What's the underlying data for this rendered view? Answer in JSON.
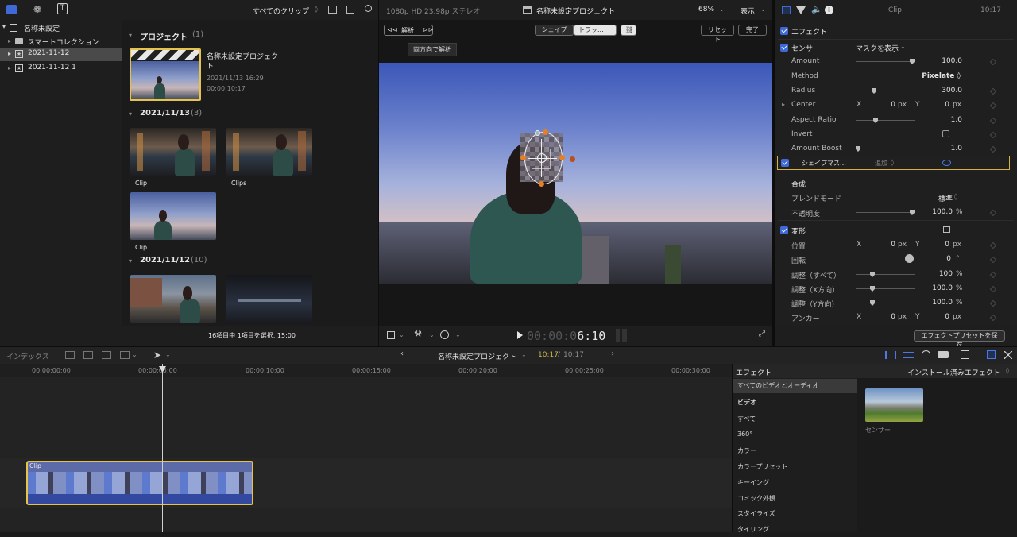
{
  "library": {
    "title": "名称未設定",
    "items": [
      {
        "label": "スマートコレクション"
      },
      {
        "label": "2021-11-12"
      },
      {
        "label": "2021-11-12 1"
      }
    ]
  },
  "browser": {
    "filter_label": "すべてのクリップ",
    "sections": [
      {
        "title": "プロジェクト",
        "count": "(1)"
      },
      {
        "title": "2021/11/13",
        "count": "(3)"
      },
      {
        "title": "2021/11/12",
        "count": "(10)"
      }
    ],
    "project": {
      "name": "名称未設定プロジェク\nト",
      "date": "2021/11/13 16:29",
      "duration": "00:00:10:17"
    },
    "clips": [
      {
        "label": "Clip"
      },
      {
        "label": "Clips"
      },
      {
        "label": "Clip"
      }
    ],
    "status": "16項目中 1項目を選択, 15:00"
  },
  "viewer": {
    "format": "1080p HD 23.98p ステレオ",
    "project_title": "名称未設定プロジェクト",
    "zoom": "68%",
    "display_label": "表示",
    "analyze_label": "解析",
    "tooltip": "両方向で解析",
    "shape_label": "シェイプ",
    "track_label": "トラッ...",
    "reset_label": "リセット",
    "done_label": "完了",
    "timecode_dim": "00:00:0",
    "timecode_bright": "6:10"
  },
  "inspector": {
    "title": "Clip",
    "time": "10:17",
    "effects_label": "エフェクト",
    "censor": {
      "name": "センサー",
      "mask_label": "マスクを表示",
      "params": [
        {
          "label": "Amount",
          "value": "100.0",
          "fraction": 0.92
        },
        {
          "label": "Method",
          "value": "Pixelate ◊"
        },
        {
          "label": "Radius",
          "value": "300.0",
          "fraction": 0.28
        },
        {
          "label": "Center",
          "x": "0",
          "y": "0",
          "unit": "px"
        },
        {
          "label": "Aspect Ratio",
          "value": "1.0",
          "fraction": 0.3
        },
        {
          "label": "Invert"
        },
        {
          "label": "Amount Boost",
          "value": "1.0",
          "fraction": 0.03
        }
      ],
      "shape_mask": "シェイプマス…",
      "add_label": "追加"
    },
    "composite": {
      "title": "合成",
      "blend_label": "ブレンドモード",
      "blend_value": "標準",
      "opacity_label": "不透明度",
      "opacity_value": "100.0",
      "opacity_unit": "%",
      "opacity_fraction": 0.92
    },
    "transform": {
      "title": "変形",
      "position_label": "位置",
      "rotation_label": "回転",
      "rotation_value": "0",
      "rotation_unit": "°",
      "scale_all_label": "調整（すべて）",
      "scale_all_value": "100",
      "scale_x_label": "調整（X方向）",
      "scale_x_value": "100.0",
      "scale_y_label": "調整（Y方向）",
      "scale_y_value": "100.0",
      "anchor_label": "アンカー",
      "x": "0",
      "y": "0",
      "px": "px",
      "pct": "%",
      "scale_fraction": 0.25
    },
    "save_preset": "エフェクトプリセットを保存"
  },
  "timeline": {
    "index_label": "インデックス",
    "project_title": "名称未設定プロジェクト",
    "time_current": "10:17",
    "time_total": "10:17",
    "ruler": [
      "00:00:00:00",
      "00:00:05:00",
      "00:00:10:00",
      "00:00:15:00",
      "00:00:20:00",
      "00:00:25:00",
      "00:00:30:00"
    ],
    "clip_label": "Clip"
  },
  "effects_browser": {
    "title": "エフェクト",
    "installed_label": "インストール済みエフェクト",
    "categories": [
      "すべてのビデオとオーディオ",
      "ビデオ",
      "すべて",
      "360°",
      "カラー",
      "カラープリセット",
      "キーイング",
      "コミック外観",
      "スタイライズ",
      "タイリング"
    ],
    "effect_name": "センサー"
  },
  "colors": {
    "accent": "#3f69d6",
    "selection": "#e6c34a",
    "handle": "#e87f24"
  }
}
